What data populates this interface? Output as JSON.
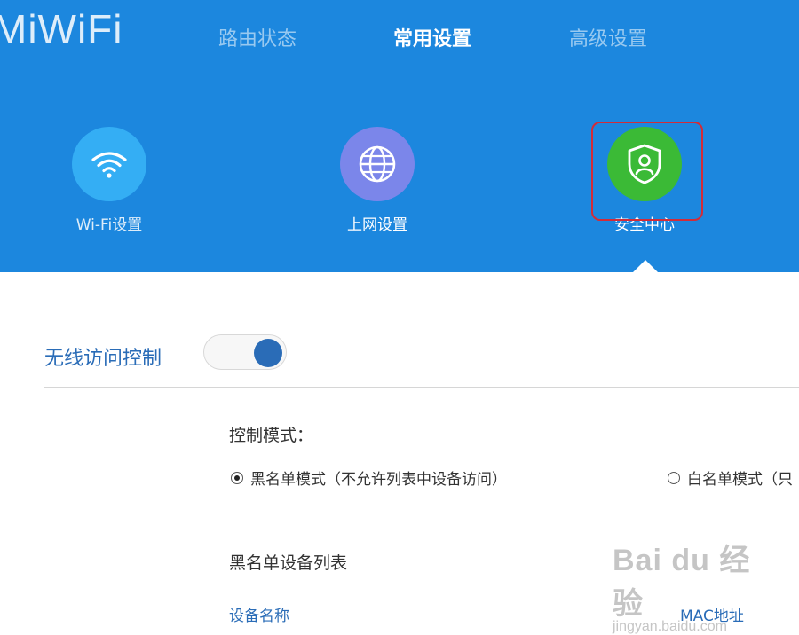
{
  "header": {
    "logo_text": "MiWiFi",
    "nav": [
      {
        "label": "路由状态",
        "active": false
      },
      {
        "label": "常用设置",
        "active": true
      },
      {
        "label": "高级设置",
        "active": false
      }
    ],
    "tiles": [
      {
        "label": "Wi-Fi设置",
        "icon": "wifi-icon",
        "color": "#34aef4"
      },
      {
        "label": "上网设置",
        "icon": "globe-icon",
        "color": "#7b86ea"
      },
      {
        "label": "安全中心",
        "icon": "shield-user-icon",
        "color": "#3bba36",
        "selected": true
      }
    ],
    "band_color": "#1c87de",
    "highlight_color": "#d22c38"
  },
  "content": {
    "section_title": "无线访问控制",
    "toggle_on": true,
    "mode_label": "控制模式：",
    "mode_options": [
      {
        "label": "黑名单模式（不允许列表中设备访问）",
        "checked": true
      },
      {
        "label": "白名单模式（只",
        "checked": false
      }
    ],
    "list_title": "黑名单设备列表",
    "columns": [
      "设备名称",
      "MAC地址"
    ]
  },
  "watermark": {
    "main": "Bai du 经验",
    "sub": "jingyan.baidu.com"
  }
}
